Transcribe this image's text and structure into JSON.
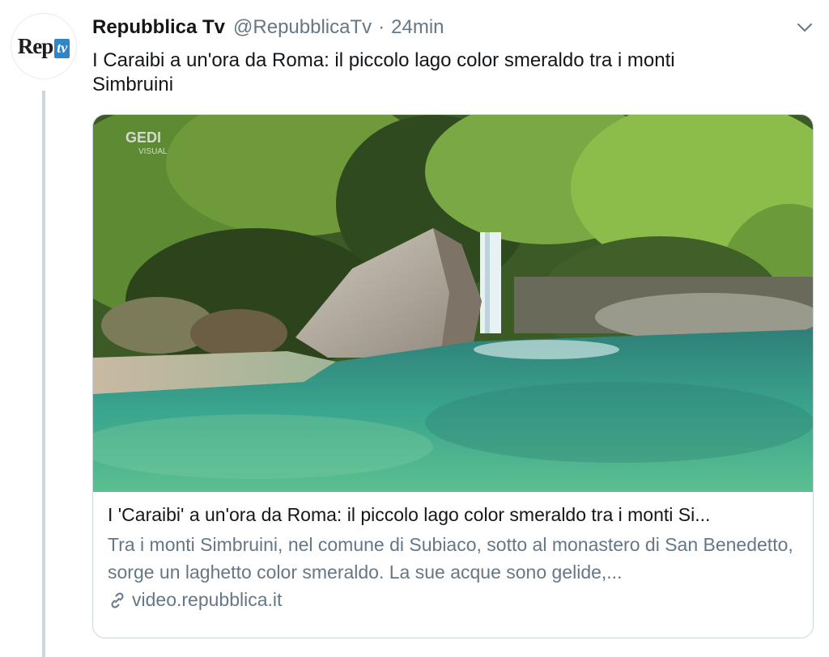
{
  "tweet": {
    "author_name": "Repubblica Tv",
    "handle": "@RepubblicaTv",
    "separator": "·",
    "time": "24min",
    "text": "I Caraibi a un'ora da Roma: il piccolo lago color smeraldo tra i monti Simbruini",
    "avatar": {
      "logo_main": "Rep",
      "logo_badge": "tv"
    },
    "menu_icon": "chevron-down-icon"
  },
  "card": {
    "image_watermark": "GEDI",
    "image_watermark_sub": "VISUAL",
    "title": "I 'Caraibi' a un'ora da Roma: il piccolo lago color smeraldo tra i monti Si...",
    "description": "Tra i monti Simbruini, nel comune di Subiaco, sotto al monastero di San Benedetto, sorge un laghetto color smeraldo. La sue acque sono gelide,...",
    "domain": "video.repubblica.it",
    "link_icon": "link-icon"
  },
  "colors": {
    "text_primary": "#14171a",
    "text_secondary": "#657786",
    "border": "#ccd6dd",
    "brand_badge": "#2e85c9"
  }
}
